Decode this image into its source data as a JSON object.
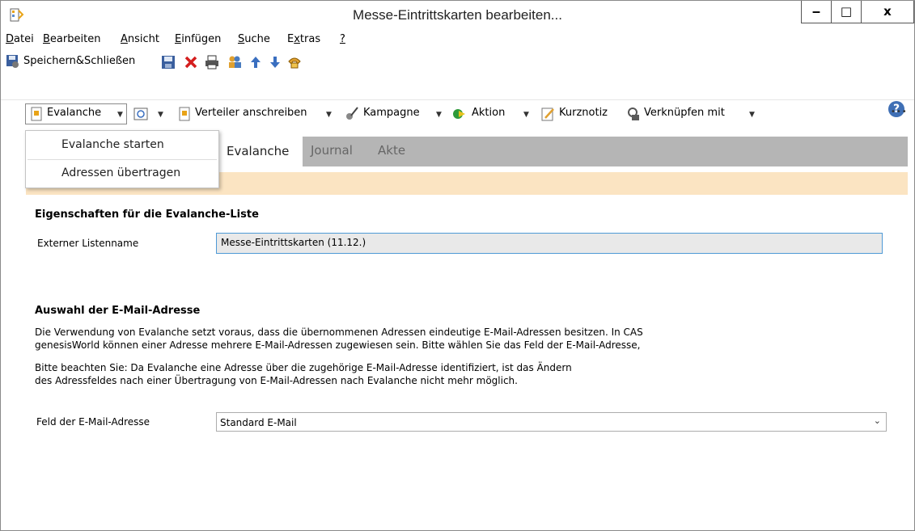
{
  "window": {
    "title": "Messe-Eintrittskarten bearbeiten...",
    "min_glyph": "‒",
    "max_glyph": "□",
    "close_glyph": "x"
  },
  "menubar": {
    "items": [
      "Datei",
      "Bearbeiten",
      "Ansicht",
      "Einfügen",
      "Suche",
      "Extras",
      "?"
    ],
    "accelerators": [
      "D",
      "B",
      "A",
      "E",
      "S",
      "x",
      "?"
    ]
  },
  "toolbar1": {
    "save_close_label": "Speichern&Schließen",
    "help_glyph": "?"
  },
  "toolbar2": {
    "evalanche_label": "Evalanche",
    "verteiler_label": "Verteiler anschreiben",
    "kampagne_label": "Kampagne",
    "aktion_label": "Aktion",
    "kurznotiz_label": "Kurznotiz",
    "verknuepfen_label": "Verknüpfen mit",
    "more_glyph": "•••"
  },
  "dropdown": {
    "items": [
      "Evalanche starten",
      "Adressen übertragen"
    ]
  },
  "tabs": {
    "items": [
      "Evalanche",
      "Journal",
      "Akte"
    ],
    "active": "Evalanche"
  },
  "section1": {
    "heading": "Eigenschaften für die Evalanche-Liste",
    "listname_label": "Externer Listenname",
    "listname_value": "Messe-Eintrittskarten (11.12.)"
  },
  "section2": {
    "heading": "Auswahl der E-Mail-Adresse",
    "para1_line1": "Die Verwendung von Evalanche setzt voraus, dass die übernommenen Adressen eindeutige E-Mail-Adressen besitzen. In CAS",
    "para1_line2": "genesisWorld können einer Adresse mehrere E-Mail-Adressen zugewiesen sein. Bitte wählen Sie das Feld der E-Mail-Adresse,",
    "para2_line1": "Bitte beachten Sie: Da Evalanche eine Adresse über die zugehörige E-Mail-Adresse identifiziert, ist das Ändern",
    "para2_line2": "des Adressfeldes nach einer Übertragung von E-Mail-Adressen nach Evalanche nicht mehr möglich.",
    "email_field_label": "Feld der E-Mail-Adresse",
    "email_field_value": "Standard E-Mail"
  },
  "colors": {
    "tab_strip": "#b5b5b5",
    "info_bar": "#fbe4c2",
    "field_border": "#4f9ad6"
  }
}
